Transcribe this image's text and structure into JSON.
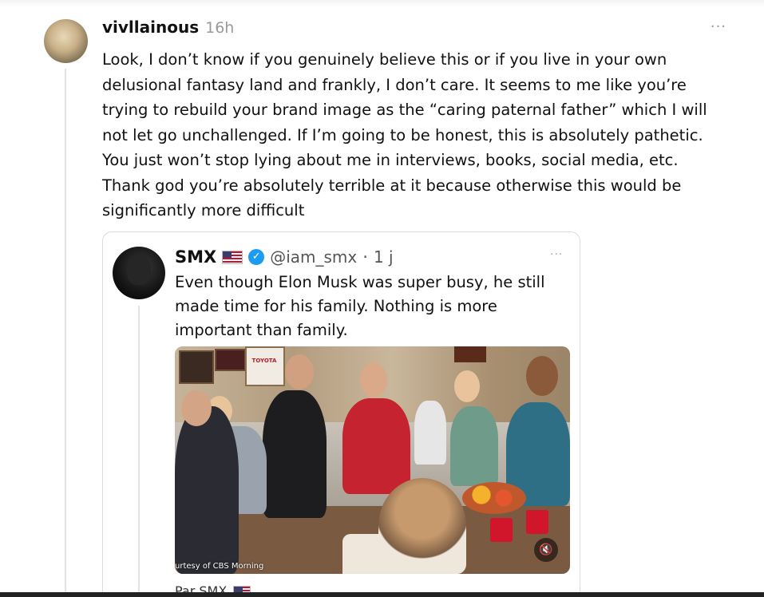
{
  "post": {
    "username": "vivllainous",
    "timestamp": "16h",
    "more_label": "···",
    "body": "Look, I don’t know if you genuinely believe this or if you live in your own delusional fantasy land and frankly, I don’t care. It seems to me like you’re trying to rebuild your brand image as the “caring paternal father” which I will not let go unchallenged. If I’m going to be honest, this is absolutely pathetic. You just won’t stop lying about me in interviews, books, social media, etc. Thank god you’re absolutely terrible at it because otherwise this would be significantly more difficult"
  },
  "quote": {
    "name": "SMX",
    "flag_icon": "us-flag-icon",
    "verified_icon": "verified-badge-icon",
    "verified_glyph": "✓",
    "handle": "@iam_smx",
    "separator": "·",
    "time": "1 j",
    "more_label": "···",
    "text": "Even though Elon Musk was super busy, he still made time for his family. Nothing is more important than family.",
    "media": {
      "caption": "urtesy of CBS Morning",
      "sign_text": "TOYOTA",
      "mute_icon": "speaker-muted-icon",
      "mute_glyph": "🔇"
    },
    "footer": {
      "text": "Par SMX",
      "flag_icon": "us-flag-icon"
    }
  }
}
